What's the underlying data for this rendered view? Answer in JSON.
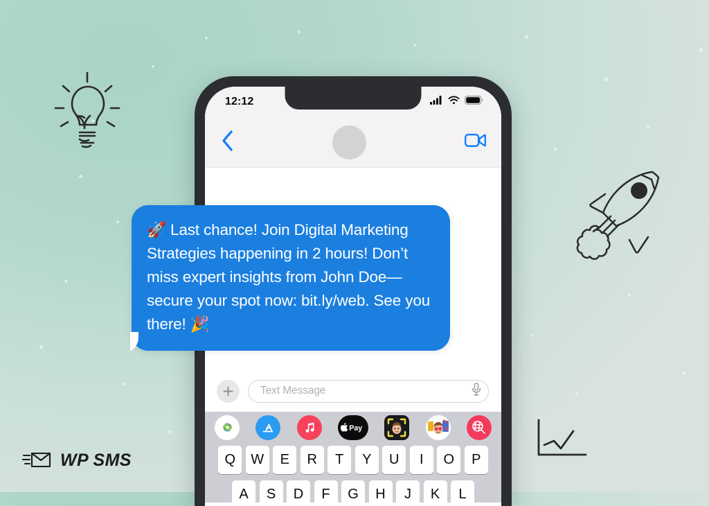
{
  "background": {
    "gradient_from": "#a9d4c6",
    "gradient_to": "#d8e2de",
    "dot_color": "#ffffff"
  },
  "brand": {
    "logo_text": "WP SMS",
    "logo_icon": "envelope-send-icon",
    "logo_color": "#1b1b1b"
  },
  "doodles": [
    {
      "name": "lightbulb-doodle",
      "label": "lightbulb"
    },
    {
      "name": "rocket-doodle",
      "label": "rocket"
    },
    {
      "name": "line-chart-doodle",
      "label": "growth chart"
    }
  ],
  "phone": {
    "frame_color": "#2c2d31",
    "status_bar": {
      "time": "12:12",
      "icons": [
        "cellular-signal-icon",
        "wifi-icon",
        "battery-icon"
      ],
      "background": "#f4f2f3"
    },
    "nav_bar": {
      "back_icon": "chevron-left-icon",
      "back_color": "#0a7cff",
      "avatar": "contact-avatar",
      "avatar_color": "#d3d3d3",
      "video_icon": "video-call-icon",
      "video_color": "#0a7cff"
    },
    "conversation": {
      "bubble": {
        "text": "🚀 Last chance! Join Digital Marketing Strategies happening in 2 hours! Don’t miss expert insights from John Doe—secure your spot now: bit.ly/web. See you there! 🎉",
        "color": "#1b7fe0",
        "text_color": "#ffffff",
        "align": "outgoing-left"
      }
    },
    "input_bar": {
      "plus_icon": "plus-icon",
      "placeholder": "Text Message",
      "mic_icon": "microphone-icon"
    },
    "app_drawer": {
      "background": "#cdced4",
      "apps": [
        {
          "name": "photos-app-icon",
          "label": "Photos"
        },
        {
          "name": "app-store-app-icon",
          "label": "App Store"
        },
        {
          "name": "music-app-icon",
          "label": "Music"
        },
        {
          "name": "apple-pay-app-icon",
          "label": "Apple Pay"
        },
        {
          "name": "memoji-app-icon",
          "label": "Memoji"
        },
        {
          "name": "memoji-stickers-app-icon",
          "label": "Memoji Stickers"
        },
        {
          "name": "images-search-app-icon",
          "label": "#images"
        }
      ]
    },
    "keyboard": {
      "background": "#cdced4",
      "row1": [
        "Q",
        "W",
        "E",
        "R",
        "T",
        "Y",
        "U",
        "I",
        "O",
        "P"
      ],
      "row2": [
        "A",
        "S",
        "D",
        "F",
        "G",
        "H",
        "J",
        "K",
        "L"
      ]
    }
  }
}
